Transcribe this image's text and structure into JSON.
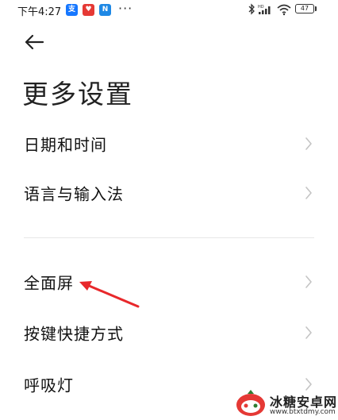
{
  "status_bar": {
    "time": "下午4:27",
    "notifications": [
      {
        "icon": "alipay-icon",
        "glyph": "支",
        "color": "#1677ff"
      },
      {
        "icon": "heart-app-icon",
        "glyph": "♥",
        "color": "#e53935"
      },
      {
        "icon": "n-app-icon",
        "glyph": "N",
        "color": "#1e88e5"
      }
    ],
    "more": "···",
    "battery": "47"
  },
  "header": {
    "back_icon": "back-arrow-icon",
    "title": "更多设置"
  },
  "settings": {
    "group1": [
      {
        "label": "日期和时间"
      },
      {
        "label": "语言与输入法"
      }
    ],
    "group2": [
      {
        "label": "全面屏"
      },
      {
        "label": "按键快捷方式"
      },
      {
        "label": "呼吸灯"
      }
    ]
  },
  "annotation": {
    "color": "#e8282b"
  },
  "watermark": {
    "name": "冰糖安卓网",
    "url": "www.btxtdmy.com"
  }
}
